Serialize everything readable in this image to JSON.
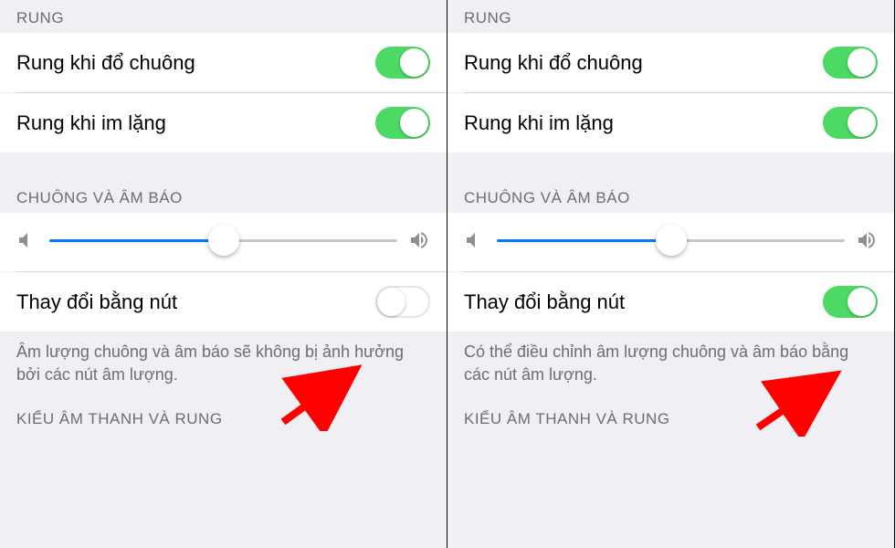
{
  "left": {
    "section_vibrate": "RUNG",
    "vibrate_ring": "Rung khi đổ chuông",
    "vibrate_silent": "Rung khi im lặng",
    "section_ringtone": "CHUÔNG VÀ ÂM BÁO",
    "change_with_buttons": "Thay đổi bằng nút",
    "change_with_buttons_state": "off",
    "footer": "Âm lượng chuông và âm báo sẽ không bị ảnh hưởng bởi các nút âm lượng.",
    "section_sound_pattern": "KIỂU ÂM THANH VÀ RUNG"
  },
  "right": {
    "section_vibrate": "RUNG",
    "vibrate_ring": "Rung khi đổ chuông",
    "vibrate_silent": "Rung khi im lặng",
    "section_ringtone": "CHUÔNG VÀ ÂM BÁO",
    "change_with_buttons": "Thay đổi bằng nút",
    "change_with_buttons_state": "on",
    "footer": "Có thể điều chỉnh âm lượng chuông và âm báo bằng các nút âm lượng.",
    "section_sound_pattern": "KIỂU ÂM THANH VÀ RUNG"
  }
}
